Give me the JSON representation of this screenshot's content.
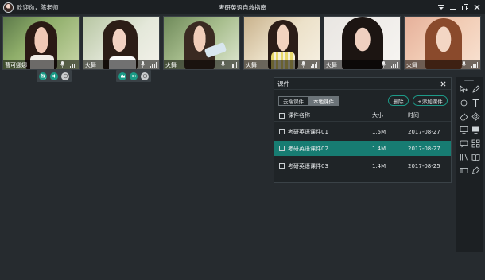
{
  "titlebar": {
    "welcome": "欢迎你，陈老师",
    "app_title": "考研英语自救指南"
  },
  "videos": [
    {
      "name": "曹可娜娜"
    },
    {
      "name": "火舞"
    },
    {
      "name": "火舞"
    },
    {
      "name": "火舞"
    },
    {
      "name": "火舞"
    },
    {
      "name": "火舞"
    }
  ],
  "courseware": {
    "title": "课件",
    "tabs": [
      "云端课件",
      "本地课件"
    ],
    "active_tab": "云端课件",
    "delete_label": "删除",
    "add_label": "+添加课件",
    "columns": {
      "name": "课件名称",
      "size": "大小",
      "time": "时间"
    },
    "rows": [
      {
        "name": "考研英语课件01",
        "size": "1.5M",
        "time": "2017-08-27",
        "selected": false
      },
      {
        "name": "考研英语课件02",
        "size": "1.4M",
        "time": "2017-08-27",
        "selected": true
      },
      {
        "name": "考研英语课件03",
        "size": "1.4M",
        "time": "2017-08-25",
        "selected": false
      }
    ]
  },
  "colors": {
    "accent": "#177c72",
    "pill_border": "#1d9a88",
    "background": "#262b2f"
  },
  "icons": {
    "toolbar": [
      "select-cursor-icon",
      "pen-icon",
      "crosshair-icon",
      "text-icon",
      "eraser-icon",
      "shape-icon",
      "monitor-icon",
      "screen-share-icon",
      "chat-icon",
      "apps-icon",
      "library-icon",
      "courseware-icon",
      "card-icon",
      "tag-icon"
    ]
  }
}
